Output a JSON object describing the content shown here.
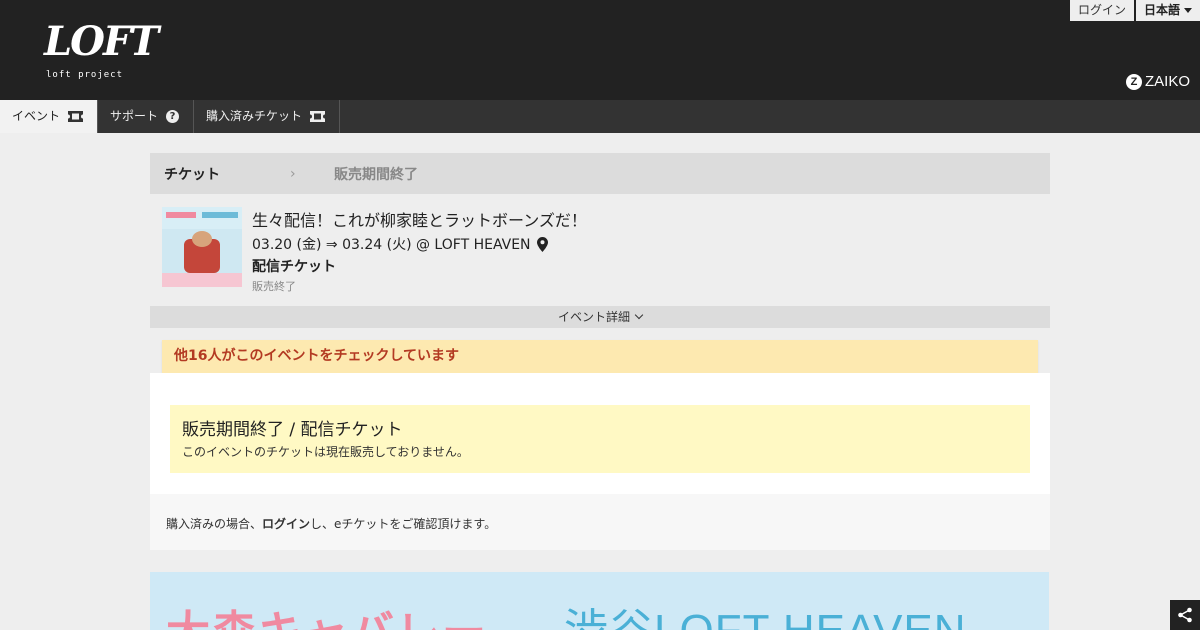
{
  "header": {
    "logo_text": "LOFT",
    "logo_sub": "loft project",
    "login_label": "ログイン",
    "language_label": "日本語",
    "brand": "ZAIKO"
  },
  "nav": {
    "tabs": [
      {
        "label": "イベント",
        "icon": "ticket-icon"
      },
      {
        "label": "サポート",
        "icon": "help-icon"
      },
      {
        "label": "購入済みチケット",
        "icon": "ticket-icon"
      }
    ]
  },
  "breadcrumb": {
    "step1": "チケット",
    "step2": "販売期間終了"
  },
  "event": {
    "title": "生々配信！これが柳家睦とラットボーンズだ！",
    "date_venue": "03.20 (金) ⇒ 03.24 (火) @ LOFT HEAVEN",
    "ticket_type": "配信チケット",
    "status": "販売終了",
    "details_label": "イベント詳細"
  },
  "notice": {
    "check_text": "他16人がこのイベントをチェックしています"
  },
  "ticket_box": {
    "title": "販売期間終了 / 配信チケット",
    "subtitle": "このイベントのチケットは現在販売しておりません。"
  },
  "purchase_note": {
    "prefix": "購入済みの場合、",
    "link": "ログイン",
    "suffix": "し、eチケットをご確認頂けます。"
  },
  "banner": {
    "left_text": "大森キャバレー",
    "right_text": "渋谷LOFT HEAVEN"
  },
  "colors": {
    "header_bg": "#222222",
    "nav_bg": "#333333",
    "notice_bg": "#fde9b0",
    "notice_text": "#b33a22",
    "ended_bg": "#fff9c4"
  }
}
